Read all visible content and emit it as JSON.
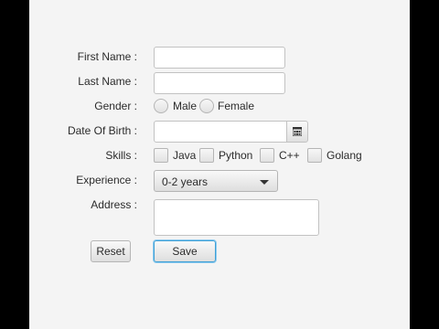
{
  "form": {
    "first_name": {
      "label": "First Name :",
      "value": ""
    },
    "last_name": {
      "label": "Last Name :",
      "value": ""
    },
    "gender": {
      "label": "Gender :",
      "options": [
        "Male",
        "Female"
      ]
    },
    "dob": {
      "label": "Date Of Birth :",
      "value": "",
      "icon": "calendar-icon"
    },
    "skills": {
      "label": "Skills :",
      "options": [
        "Java",
        "Python",
        "C++",
        "Golang"
      ]
    },
    "experience": {
      "label": "Experience :",
      "selected": "0-2 years",
      "icon": "chevron-down-icon"
    },
    "address": {
      "label": "Address :",
      "value": ""
    }
  },
  "buttons": {
    "reset": "Reset",
    "save": "Save"
  },
  "colors": {
    "background": "#f4f4f4",
    "letterbox": "#000000",
    "focus_ring": "#3ea0d6",
    "field_border": "#c2c2c2"
  }
}
